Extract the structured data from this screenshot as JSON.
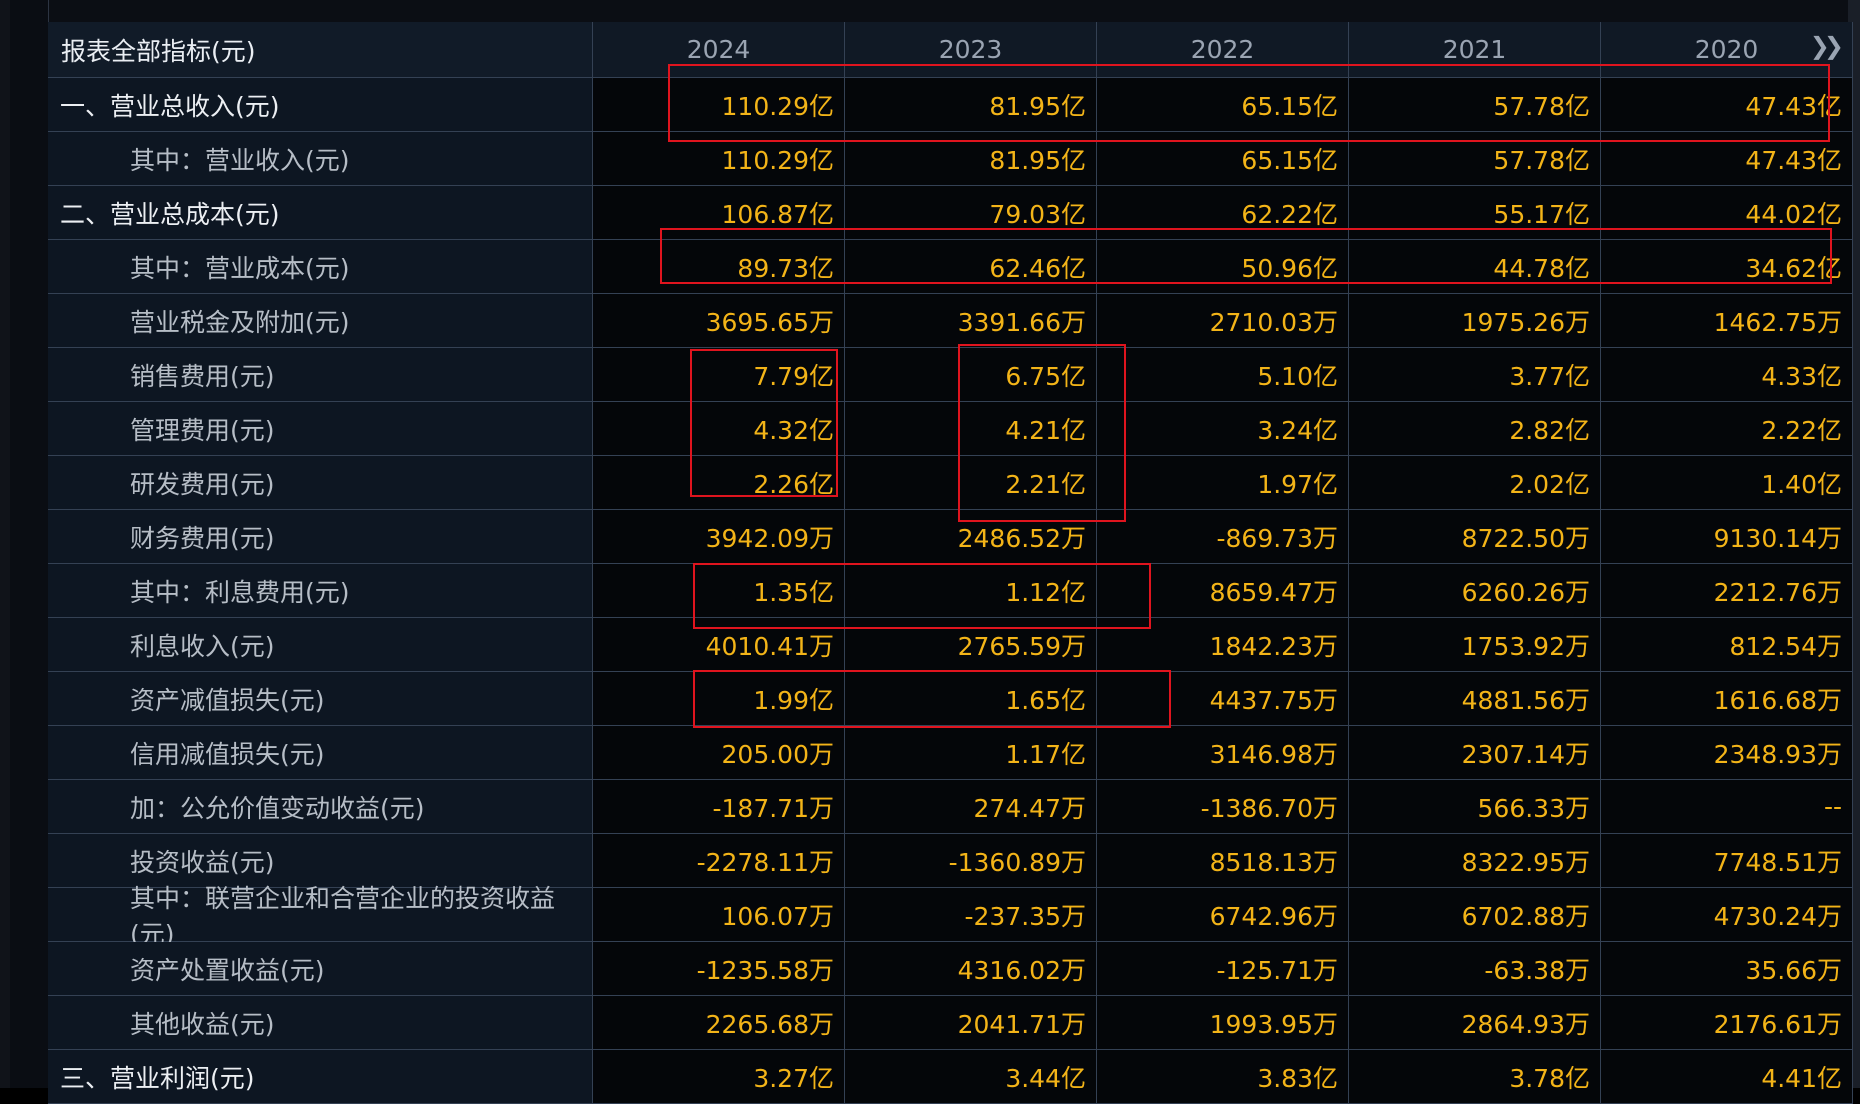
{
  "table": {
    "header_label": "报表全部指标(元)",
    "years": [
      "2024",
      "2023",
      "2022",
      "2021",
      "2020"
    ],
    "rows": [
      {
        "label": "一、营业总收入(元)",
        "level": 0,
        "values": [
          "110.29亿",
          "81.95亿",
          "65.15亿",
          "57.78亿",
          "47.43亿"
        ]
      },
      {
        "label": "其中：营业收入(元)",
        "level": 1,
        "values": [
          "110.29亿",
          "81.95亿",
          "65.15亿",
          "57.78亿",
          "47.43亿"
        ]
      },
      {
        "label": "二、营业总成本(元)",
        "level": 0,
        "values": [
          "106.87亿",
          "79.03亿",
          "62.22亿",
          "55.17亿",
          "44.02亿"
        ]
      },
      {
        "label": "其中：营业成本(元)",
        "level": 1,
        "values": [
          "89.73亿",
          "62.46亿",
          "50.96亿",
          "44.78亿",
          "34.62亿"
        ]
      },
      {
        "label": "营业税金及附加(元)",
        "level": 1,
        "values": [
          "3695.65万",
          "3391.66万",
          "2710.03万",
          "1975.26万",
          "1462.75万"
        ]
      },
      {
        "label": "销售费用(元)",
        "level": 1,
        "values": [
          "7.79亿",
          "6.75亿",
          "5.10亿",
          "3.77亿",
          "4.33亿"
        ]
      },
      {
        "label": "管理费用(元)",
        "level": 1,
        "values": [
          "4.32亿",
          "4.21亿",
          "3.24亿",
          "2.82亿",
          "2.22亿"
        ]
      },
      {
        "label": "研发费用(元)",
        "level": 1,
        "values": [
          "2.26亿",
          "2.21亿",
          "1.97亿",
          "2.02亿",
          "1.40亿"
        ]
      },
      {
        "label": "财务费用(元)",
        "level": 1,
        "values": [
          "3942.09万",
          "2486.52万",
          "-869.73万",
          "8722.50万",
          "9130.14万"
        ]
      },
      {
        "label": "其中：利息费用(元)",
        "level": 1,
        "values": [
          "1.35亿",
          "1.12亿",
          "8659.47万",
          "6260.26万",
          "2212.76万"
        ]
      },
      {
        "label": "利息收入(元)",
        "level": 1,
        "values": [
          "4010.41万",
          "2765.59万",
          "1842.23万",
          "1753.92万",
          "812.54万"
        ]
      },
      {
        "label": "资产减值损失(元)",
        "level": 1,
        "values": [
          "1.99亿",
          "1.65亿",
          "4437.75万",
          "4881.56万",
          "1616.68万"
        ]
      },
      {
        "label": "信用减值损失(元)",
        "level": 1,
        "values": [
          "205.00万",
          "1.17亿",
          "3146.98万",
          "2307.14万",
          "2348.93万"
        ]
      },
      {
        "label": "加：公允价值变动收益(元)",
        "level": 1,
        "values": [
          "-187.71万",
          "274.47万",
          "-1386.70万",
          "566.33万",
          "--"
        ]
      },
      {
        "label": "投资收益(元)",
        "level": 1,
        "values": [
          "-2278.11万",
          "-1360.89万",
          "8518.13万",
          "8322.95万",
          "7748.51万"
        ]
      },
      {
        "label": "其中：联营企业和合营企业的投资收益(元)",
        "level": 1,
        "values": [
          "106.07万",
          "-237.35万",
          "6742.96万",
          "6702.88万",
          "4730.24万"
        ]
      },
      {
        "label": "资产处置收益(元)",
        "level": 1,
        "values": [
          "-1235.58万",
          "4316.02万",
          "-125.71万",
          "-63.38万",
          "35.66万"
        ]
      },
      {
        "label": "其他收益(元)",
        "level": 1,
        "values": [
          "2265.68万",
          "2041.71万",
          "1993.95万",
          "2864.93万",
          "2176.61万"
        ]
      },
      {
        "label": "三、营业利润(元)",
        "level": 0,
        "values": [
          "3.27亿",
          "3.44亿",
          "3.83亿",
          "3.78亿",
          "4.41亿"
        ]
      }
    ]
  },
  "icons": {
    "next_columns": "double-chevron-right-icon"
  },
  "colors": {
    "value_text": "#f3b418",
    "annotation_box": "#e0141e",
    "label_text": "#b6bdc6"
  }
}
